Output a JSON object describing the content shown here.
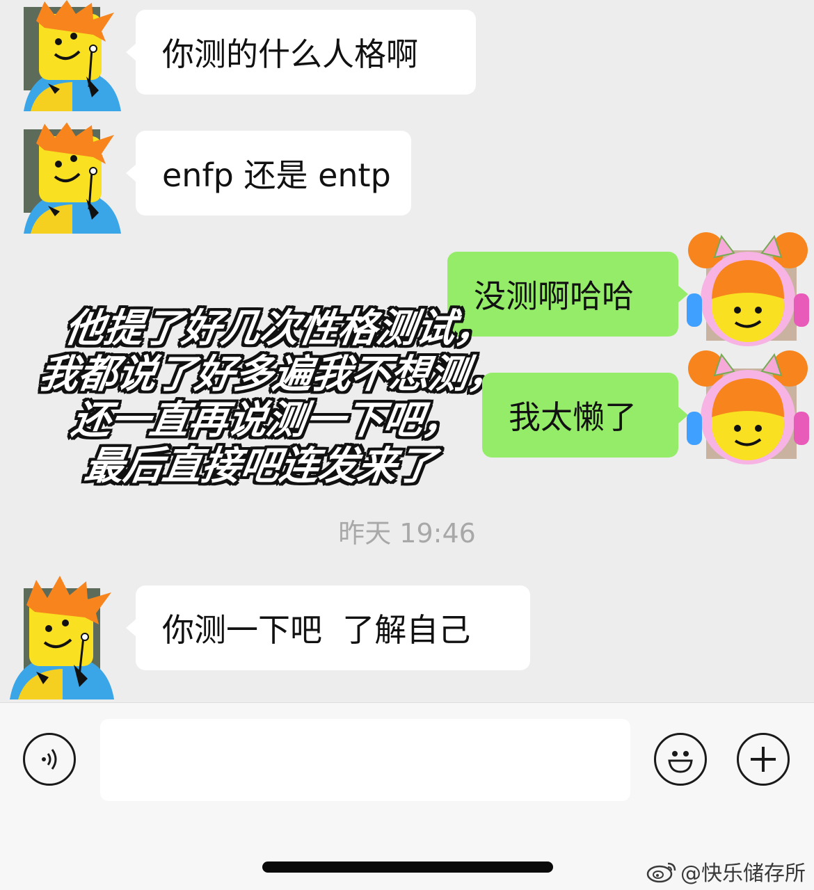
{
  "messages": [
    {
      "side": "in",
      "text": "你测的什么人格啊"
    },
    {
      "side": "in",
      "text": "enfp 还是 entp"
    },
    {
      "side": "out",
      "text": "没测啊哈哈"
    },
    {
      "side": "out",
      "text": "我太懒了"
    },
    {
      "side": "in",
      "text": "你测一下吧  了解自己"
    }
  ],
  "timestamp": "昨天 19:46",
  "caption": {
    "lines": [
      "他提了好几次性格测试，",
      "我都说了好多遍我不想测，",
      "还一直再说测一下吧，",
      "最后直接吧连发来了"
    ]
  },
  "input_bar": {
    "voice_icon": "voice-icon",
    "emoji_icon": "emoji-icon",
    "plus_icon": "plus-icon",
    "text_value": ""
  },
  "watermark": {
    "text": "@快乐储存所",
    "icon": "weibo-logo"
  },
  "colors": {
    "background": "#ededed",
    "incoming_bubble": "#ffffff",
    "outgoing_bubble": "#95ec69",
    "timestamp": "#a8a8a8"
  }
}
